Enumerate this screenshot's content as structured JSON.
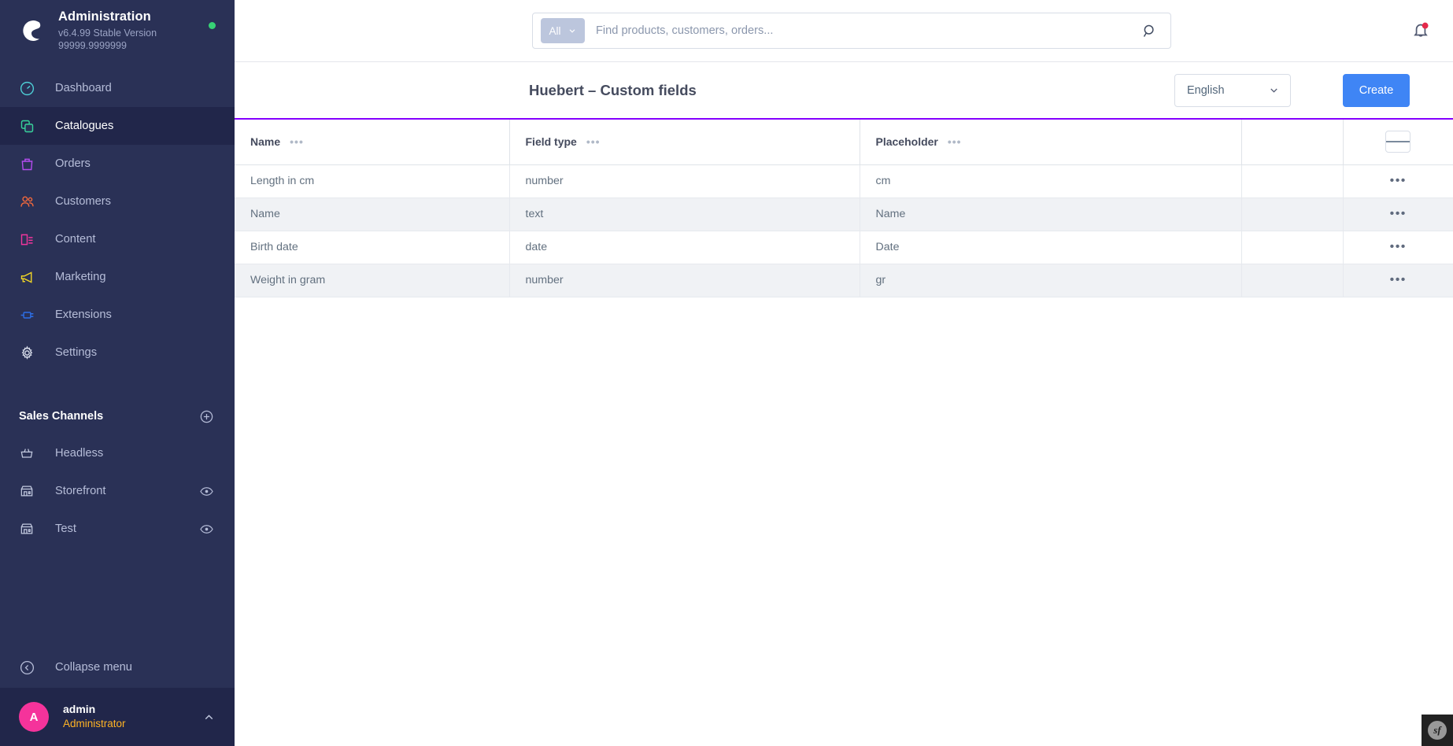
{
  "sidebar": {
    "brand": {
      "title": "Administration",
      "version": "v6.4.99 Stable Version 99999.9999999",
      "status": "online",
      "status_color": "#37d275"
    },
    "nav": [
      {
        "label": "Dashboard",
        "icon": "dashboard-icon",
        "color": "#4ecfd6",
        "active": false
      },
      {
        "label": "Catalogues",
        "icon": "catalogues-icon",
        "color": "#37d39b",
        "active": true
      },
      {
        "label": "Orders",
        "icon": "orders-icon",
        "color": "#b54cf0",
        "active": false
      },
      {
        "label": "Customers",
        "icon": "customers-icon",
        "color": "#f2683c",
        "active": false
      },
      {
        "label": "Content",
        "icon": "content-icon",
        "color": "#f2359d",
        "active": false
      },
      {
        "label": "Marketing",
        "icon": "marketing-icon",
        "color": "#f0d526",
        "active": false
      },
      {
        "label": "Extensions",
        "icon": "extensions-icon",
        "color": "#2d6fe8",
        "active": false
      },
      {
        "label": "Settings",
        "icon": "settings-icon",
        "color": "#d3d8e6",
        "active": false
      }
    ],
    "sales_channels": {
      "title": "Sales Channels",
      "add_label": "plus-circle-icon",
      "items": [
        {
          "label": "Headless",
          "icon": "basket-icon",
          "has_eye": false
        },
        {
          "label": "Storefront",
          "icon": "store-icon",
          "has_eye": true
        },
        {
          "label": "Test",
          "icon": "store-icon",
          "has_eye": true
        }
      ]
    },
    "collapse_label": "Collapse menu",
    "user": {
      "initial": "A",
      "name": "admin",
      "role": "Administrator",
      "avatar_color": "#f5339b",
      "role_color": "#ffb324"
    }
  },
  "topbar": {
    "search": {
      "scope": "All",
      "placeholder": "Find products, customers, orders...",
      "value": ""
    },
    "notification": {
      "icon": "bell-icon",
      "badge": true,
      "badge_color": "#e5294a"
    }
  },
  "pagehead": {
    "title": "Huebert – Custom fields",
    "language": "English",
    "create_label": "Create",
    "accent_color": "#8400ff",
    "create_color": "#3f85f5"
  },
  "table": {
    "columns": [
      {
        "label": "Name",
        "menu": "•••"
      },
      {
        "label": "Field type",
        "menu": "•••"
      },
      {
        "label": "Placeholder",
        "menu": "•••"
      },
      {
        "label": "",
        "menu": ""
      },
      {
        "label": "",
        "menu": ""
      }
    ],
    "settings_icon": "hamburger-icon",
    "rows": [
      {
        "name": "Length in cm",
        "field_type": "number",
        "placeholder": "cm",
        "extra": "",
        "actions": "•••"
      },
      {
        "name": "Name",
        "field_type": "text",
        "placeholder": "Name",
        "extra": "",
        "actions": "•••"
      },
      {
        "name": "Birth date",
        "field_type": "date",
        "placeholder": "Date",
        "extra": "",
        "actions": "•••"
      },
      {
        "name": "Weight in gram",
        "field_type": "number",
        "placeholder": "gr",
        "extra": "",
        "actions": "•••"
      }
    ]
  },
  "debug_toolbar": {
    "label": "sf"
  }
}
